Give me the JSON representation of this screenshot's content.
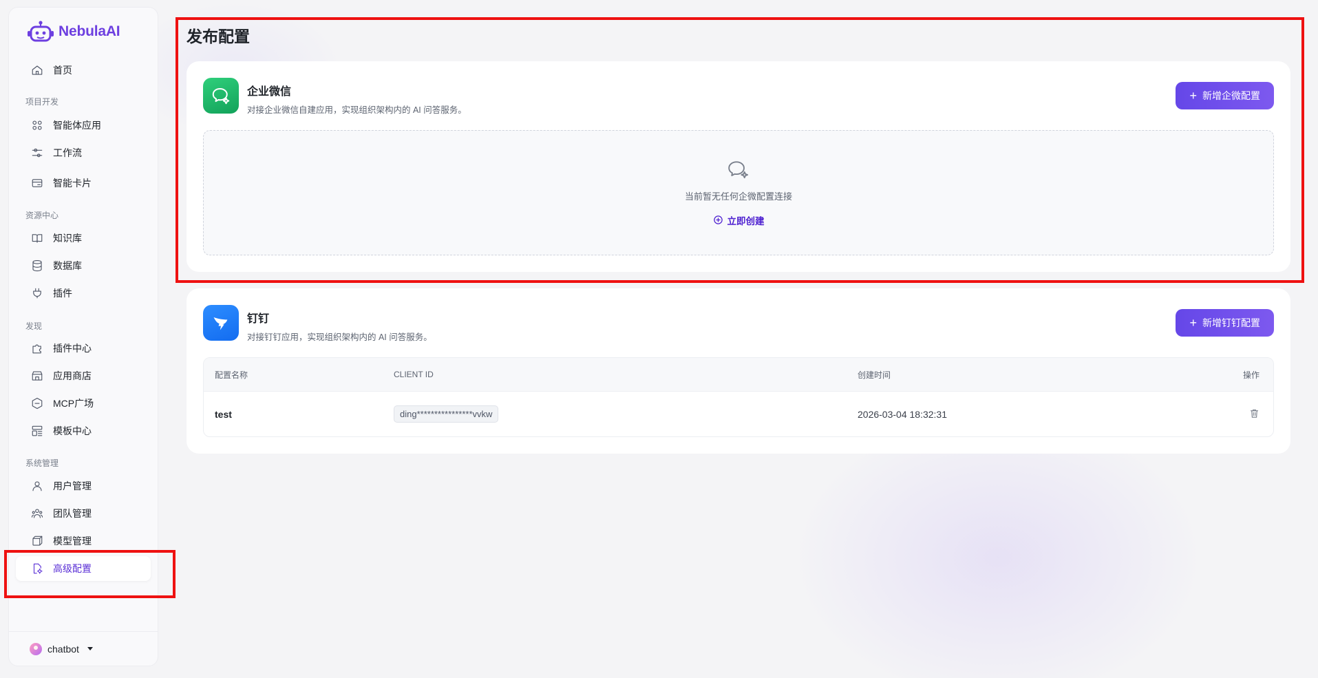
{
  "app": {
    "name": "NebulaAI",
    "brand_color": "#6d3fe0",
    "accent_color": "#5b30d6"
  },
  "sidebar": {
    "home": {
      "label": "首页",
      "icon": "home-icon"
    },
    "groups": {
      "dev": "项目开发",
      "resources": "资源中心",
      "discover": "发现",
      "system": "系统管理"
    },
    "items": {
      "agent_apps": "智能体应用",
      "workflow": "工作流",
      "smart_card": "智能卡片",
      "knowledge": "知识库",
      "database": "数据库",
      "plugins": "插件",
      "plugin_center": "插件中心",
      "app_store": "应用商店",
      "mcp_square": "MCP广场",
      "template_center": "模板中心",
      "user_mgmt": "用户管理",
      "team_mgmt": "团队管理",
      "model_mgmt": "模型管理",
      "advanced_config": "高级配置"
    },
    "active": "advanced_config",
    "user": {
      "name": "chatbot"
    }
  },
  "main": {
    "title": "发布配置",
    "wecom": {
      "title": "企业微信",
      "desc": "对接企业微信自建应用，实现组织架构内的 AI 问答服务。",
      "add_button": "新增企微配置",
      "empty_text": "当前暂无任何企微配置连接",
      "create_link": "立即创建",
      "icon_color": "#1aaf62"
    },
    "dingtalk": {
      "title": "钉钉",
      "desc": "对接钉钉应用，实现组织架构内的 AI 问答服务。",
      "add_button": "新增钉钉配置",
      "icon_color": "#1677ff",
      "table": {
        "headers": [
          "配置名称",
          "CLIENT ID",
          "创建时间",
          "操作"
        ],
        "rows": [
          {
            "name": "test",
            "client_id": "ding****************vvkw",
            "created": "2026-03-04 18:32:31",
            "action_icon": "trash-icon"
          }
        ]
      }
    }
  },
  "highlight_color": "#ee1111"
}
